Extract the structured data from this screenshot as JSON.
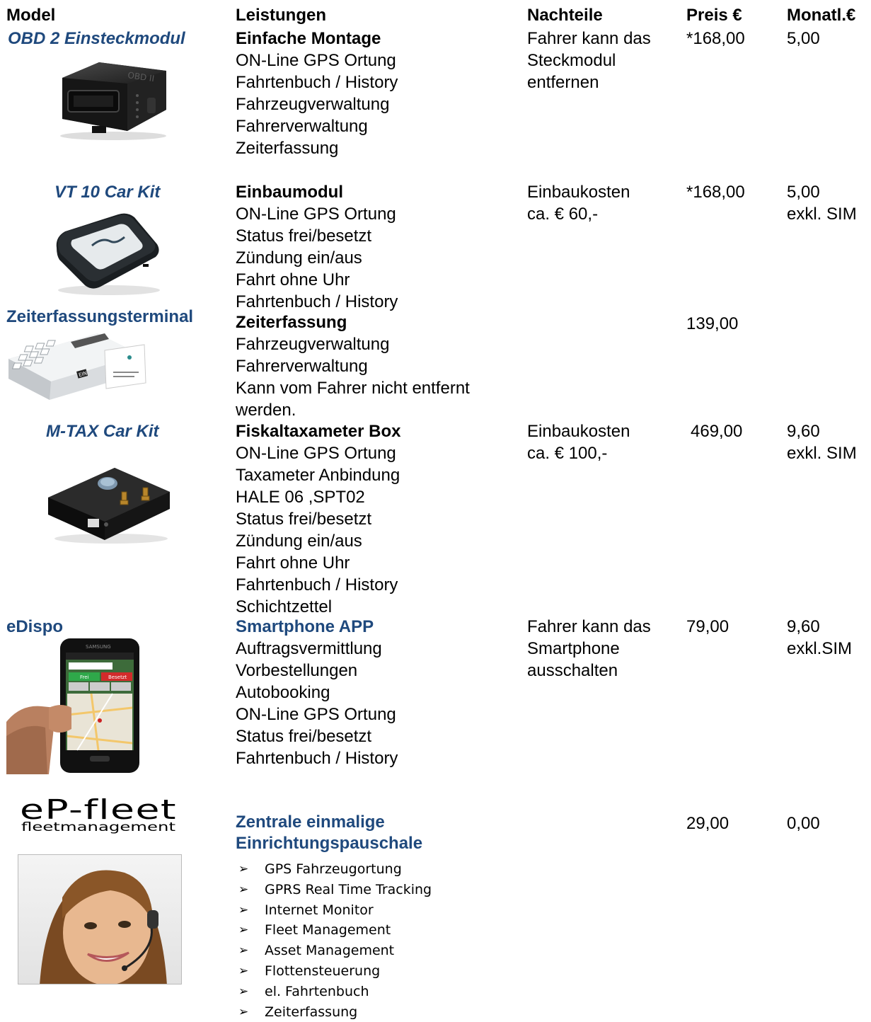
{
  "headers": {
    "model": "Model",
    "leistungen": "Leistungen",
    "nachteile": "Nachteile",
    "preis": "Preis  €",
    "monatl": "Monatl.€"
  },
  "products": [
    {
      "name": "OBD 2 Einsteckmodul",
      "features": [
        "Einfache Montage",
        "ON-Line GPS Ortung",
        "Fahrtenbuch / History",
        "Fahrzeugverwaltung",
        "Fahrerverwaltung",
        "Zeiterfassung"
      ],
      "nachteile": [
        "Fahrer kann das",
        "Steckmodul",
        "entfernen"
      ],
      "preis": "*168,00",
      "monatl": [
        "5,00"
      ]
    },
    {
      "name": "VT 10 Car Kit",
      "features": [
        "Einbaumodul",
        "ON-Line GPS Ortung",
        "Status frei/besetzt",
        "Zündung ein/aus",
        "Fahrt ohne Uhr",
        "Fahrtenbuch / History"
      ],
      "nachteile": [
        "Einbaukosten",
        "ca. € 60,-"
      ],
      "preis": "*168,00",
      "monatl": [
        "5,00",
        "exkl. SIM"
      ]
    },
    {
      "name": "Zeiterfassungsterminal",
      "features": [
        "Zeiterfassung",
        "Fahrzeugverwaltung",
        "Fahrerverwaltung",
        "Kann vom Fahrer nicht entfernt",
        "werden."
      ],
      "preis": "139,00"
    },
    {
      "name": "M-TAX  Car Kit",
      "features": [
        "Fiskaltaxameter Box",
        "ON-Line GPS Ortung",
        "Taxameter Anbindung",
        "HALE 06 ,SPT02",
        "Status frei/besetzt",
        "Zündung ein/aus",
        "Fahrt ohne Uhr",
        "Fahrtenbuch / History",
        "Schichtzettel"
      ],
      "nachteile": [
        "Einbaukosten",
        "ca. € 100,-"
      ],
      "preis": "469,00",
      "monatl": [
        "9,60",
        "exkl. SIM"
      ]
    },
    {
      "name": "eDispo",
      "features": [
        "Smartphone APP",
        "Auftragsvermittlung",
        "Vorbestellungen",
        "Autobooking",
        "ON-Line GPS Ortung",
        "Status frei/besetzt",
        "Fahrtenbuch / History"
      ],
      "nachteile": [
        "Fahrer kann das",
        "Smartphone",
        "ausschalten"
      ],
      "preis": "79,00",
      "monatl": [
        "9,60",
        "exkl.SIM"
      ]
    }
  ],
  "logo": {
    "brand": "eP-fleet",
    "tagline": "fleetmanagement"
  },
  "central": {
    "title": [
      "Zentrale einmalige",
      "Einrichtungspauschale"
    ],
    "preis": "29,00",
    "monatl": "0,00",
    "bullets": [
      "GPS Fahrzeugortung",
      "GPRS Real Time Tracking",
      "Internet Monitor",
      "Fleet Management",
      "Asset Management",
      "Flottensteuerung",
      "el. Fahrtenbuch",
      "Zeiterfassung"
    ]
  },
  "phone_screen": {
    "btn_left": "Frei",
    "btn_right": "Besetzt"
  },
  "terminal_label": "EIN",
  "colors": {
    "title_blue": "#1f497d"
  }
}
